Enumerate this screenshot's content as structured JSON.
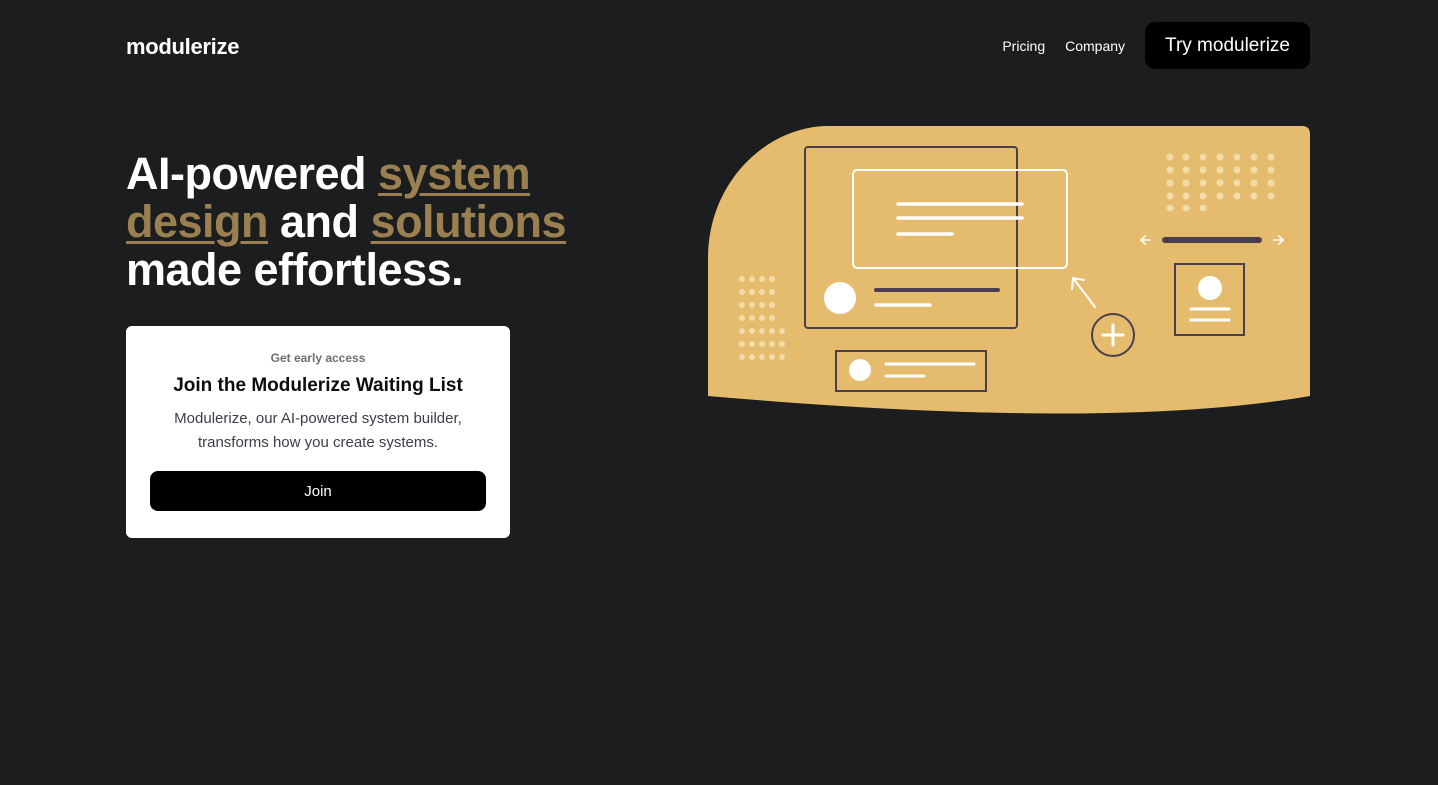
{
  "header": {
    "logo": "modulerize",
    "nav": [
      "Pricing",
      "Company"
    ],
    "cta": "Try modulerize"
  },
  "hero": {
    "title_part1": "AI-powered ",
    "title_highlight1": "system design",
    "title_part2": " and ",
    "title_highlight2": "solutions",
    "title_part3": " made effortless."
  },
  "waitlist": {
    "eyebrow": "Get early access",
    "title": "Join the Modulerize Waiting List",
    "description": "Modulerize, our AI-powered system builder, transforms how you create systems.",
    "button": "Join"
  },
  "colors": {
    "background": "#1b1d1e",
    "accent": "#e5bc6e",
    "highlight_text": "#9a8050",
    "stroke": "#4a3f4f"
  }
}
